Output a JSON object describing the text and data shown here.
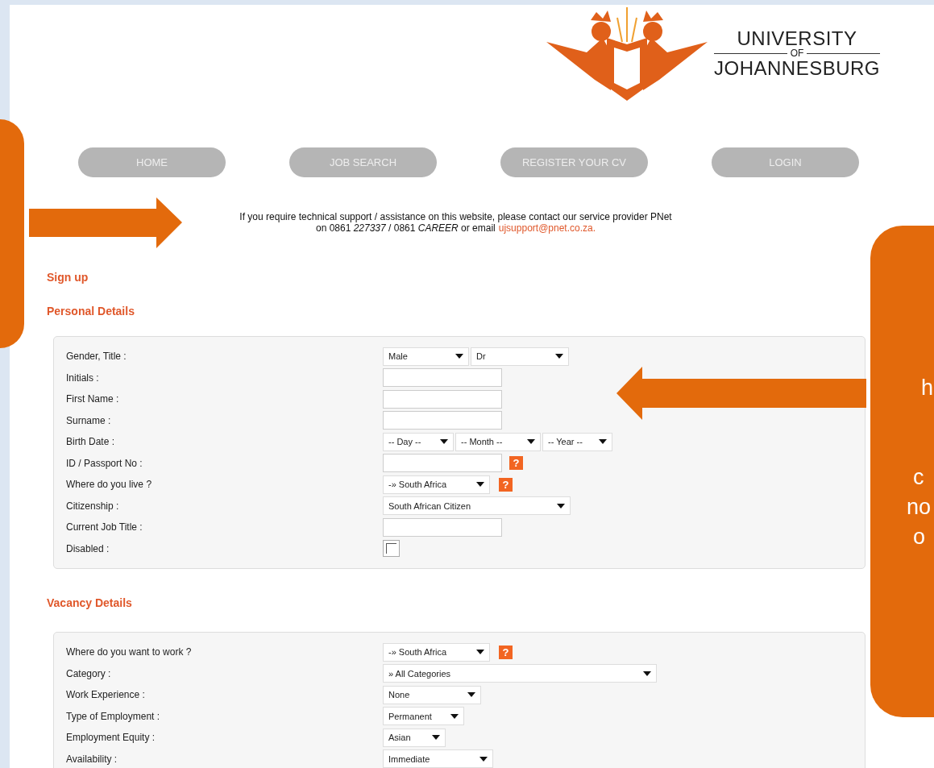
{
  "logo": {
    "line1": "UNIVERSITY",
    "line2": "OF",
    "line3": "JOHANNESBURG"
  },
  "nav": [
    {
      "label": "HOME"
    },
    {
      "label": "JOB SEARCH"
    },
    {
      "label": "REGISTER YOUR CV"
    },
    {
      "label": "LOGIN"
    }
  ],
  "support_notice": {
    "line1": "If you require technical support / assistance on this website, please contact our service provider PNet",
    "line2": "on 0861 *227337* / 0861 *CAREER* or email",
    "email": "ujsupport@pnet.co.za."
  },
  "page_title": "Sign up",
  "sections": [
    {
      "title": "Personal Details",
      "fields": [
        {
          "label": "Gender, Title :",
          "kind": "select",
          "controls": [
            {
              "value": "Male"
            },
            {
              "value": "Dr"
            }
          ]
        },
        {
          "label": "Initials :",
          "kind": "text"
        },
        {
          "label": "First Name :",
          "kind": "text"
        },
        {
          "label": "Surname :",
          "kind": "text"
        },
        {
          "label": "Birth Date :",
          "kind": "select",
          "controls": [
            {
              "value": "-- Day --"
            },
            {
              "value": "-- Month --"
            },
            {
              "value": "-- Year --"
            }
          ]
        },
        {
          "label": "ID / Passport No :",
          "kind": "text",
          "help": "?"
        },
        {
          "label": "Where do you live ?",
          "kind": "select",
          "controls": [
            {
              "value": "-» South Africa"
            }
          ],
          "help": "?"
        },
        {
          "label": "Citizenship :",
          "kind": "select",
          "controls": [
            {
              "value": "South African Citizen"
            }
          ]
        },
        {
          "label": "Current Job Title :",
          "kind": "text"
        },
        {
          "label": "Disabled :",
          "kind": "checkbox",
          "checked": false
        }
      ]
    },
    {
      "title": "Vacancy Details",
      "fields": [
        {
          "label": "Where do you want to work ?",
          "kind": "select",
          "controls": [
            {
              "value": "-» South Africa"
            }
          ],
          "help": "?"
        },
        {
          "label": "Category :",
          "kind": "select",
          "controls": [
            {
              "value": "» All Categories"
            }
          ]
        },
        {
          "label": "Work Experience :",
          "kind": "select",
          "controls": [
            {
              "value": "None"
            }
          ]
        },
        {
          "label": "Type of Employment :",
          "kind": "select",
          "controls": [
            {
              "value": "Permanent"
            }
          ]
        },
        {
          "label": "Employment Equity :",
          "kind": "select",
          "controls": [
            {
              "value": "Asian"
            }
          ]
        },
        {
          "label": "Availability :",
          "kind": "select",
          "controls": [
            {
              "value": "Immediate"
            }
          ]
        }
      ]
    }
  ],
  "annotation_callout": {
    "lines": [
      "h",
      "c",
      "no",
      "o"
    ]
  }
}
